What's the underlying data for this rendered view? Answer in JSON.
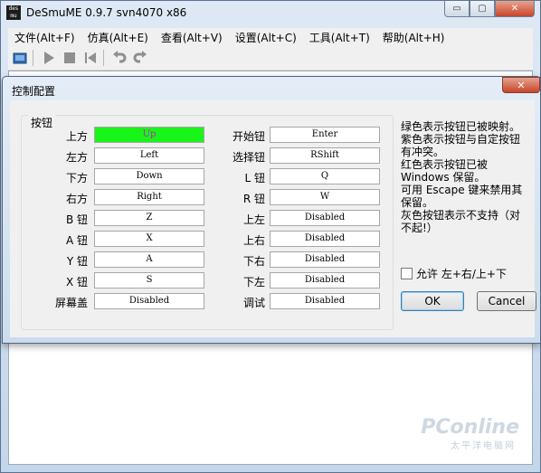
{
  "window": {
    "title": "DeSmuME 0.9.7 svn4070 x86",
    "icon": "desmume-app-icon",
    "icon_text": "des mu me",
    "controls": {
      "minimize": "▭",
      "maximize": "▢",
      "close": "✕"
    }
  },
  "menubar": [
    "文件(Alt+F)",
    "仿真(Alt+E)",
    "查看(Alt+V)",
    "设置(Alt+C)",
    "工具(Alt+T)",
    "帮助(Alt+H)"
  ],
  "toolbar": {
    "icons": [
      "open-rom-icon",
      "play-icon",
      "stop-icon",
      "reset-icon",
      "undo-icon",
      "redo-icon"
    ]
  },
  "dialog": {
    "title": "控制配置",
    "close": "✕",
    "group_label": "按钮",
    "left_rows": [
      {
        "label": "上方",
        "value": "Up",
        "mapped": true
      },
      {
        "label": "左方",
        "value": "Left",
        "mapped": false
      },
      {
        "label": "下方",
        "value": "Down",
        "mapped": false
      },
      {
        "label": "右方",
        "value": "Right",
        "mapped": false
      },
      {
        "label": "B 钮",
        "value": "Z",
        "mapped": false
      },
      {
        "label": "A 钮",
        "value": "X",
        "mapped": false
      },
      {
        "label": "Y 钮",
        "value": "A",
        "mapped": false
      },
      {
        "label": "X 钮",
        "value": "S",
        "mapped": false
      },
      {
        "label": "屏幕盖",
        "value": "Disabled",
        "mapped": false
      }
    ],
    "right_rows": [
      {
        "label": "开始钮",
        "value": "Enter"
      },
      {
        "label": "选择钮",
        "value": "RShift"
      },
      {
        "label": "L 钮",
        "value": "Q"
      },
      {
        "label": "R 钮",
        "value": "W"
      },
      {
        "label": "上左",
        "value": "Disabled"
      },
      {
        "label": "上右",
        "value": "Disabled"
      },
      {
        "label": "下右",
        "value": "Disabled"
      },
      {
        "label": "下左",
        "value": "Disabled"
      },
      {
        "label": "调试",
        "value": "Disabled"
      }
    ],
    "info": "绿色表示按钮已被映射。\n紫色表示按钮与自定按钮\n有冲突。\n红色表示按钮已被\nWindows 保留。\n可用 Escape 键来禁用其\n保留。\n灰色按钮表示不支持（对\n不起!）",
    "allow_label": "允许 左+右/上+下",
    "allow_checked": false,
    "ok_label": "OK",
    "cancel_label": "Cancel"
  },
  "watermark": {
    "text": "PConline",
    "sub": "太平洋电脑网"
  },
  "colors": {
    "mapped_bg": "#19f519",
    "conflict_text": "#c01ec0"
  }
}
